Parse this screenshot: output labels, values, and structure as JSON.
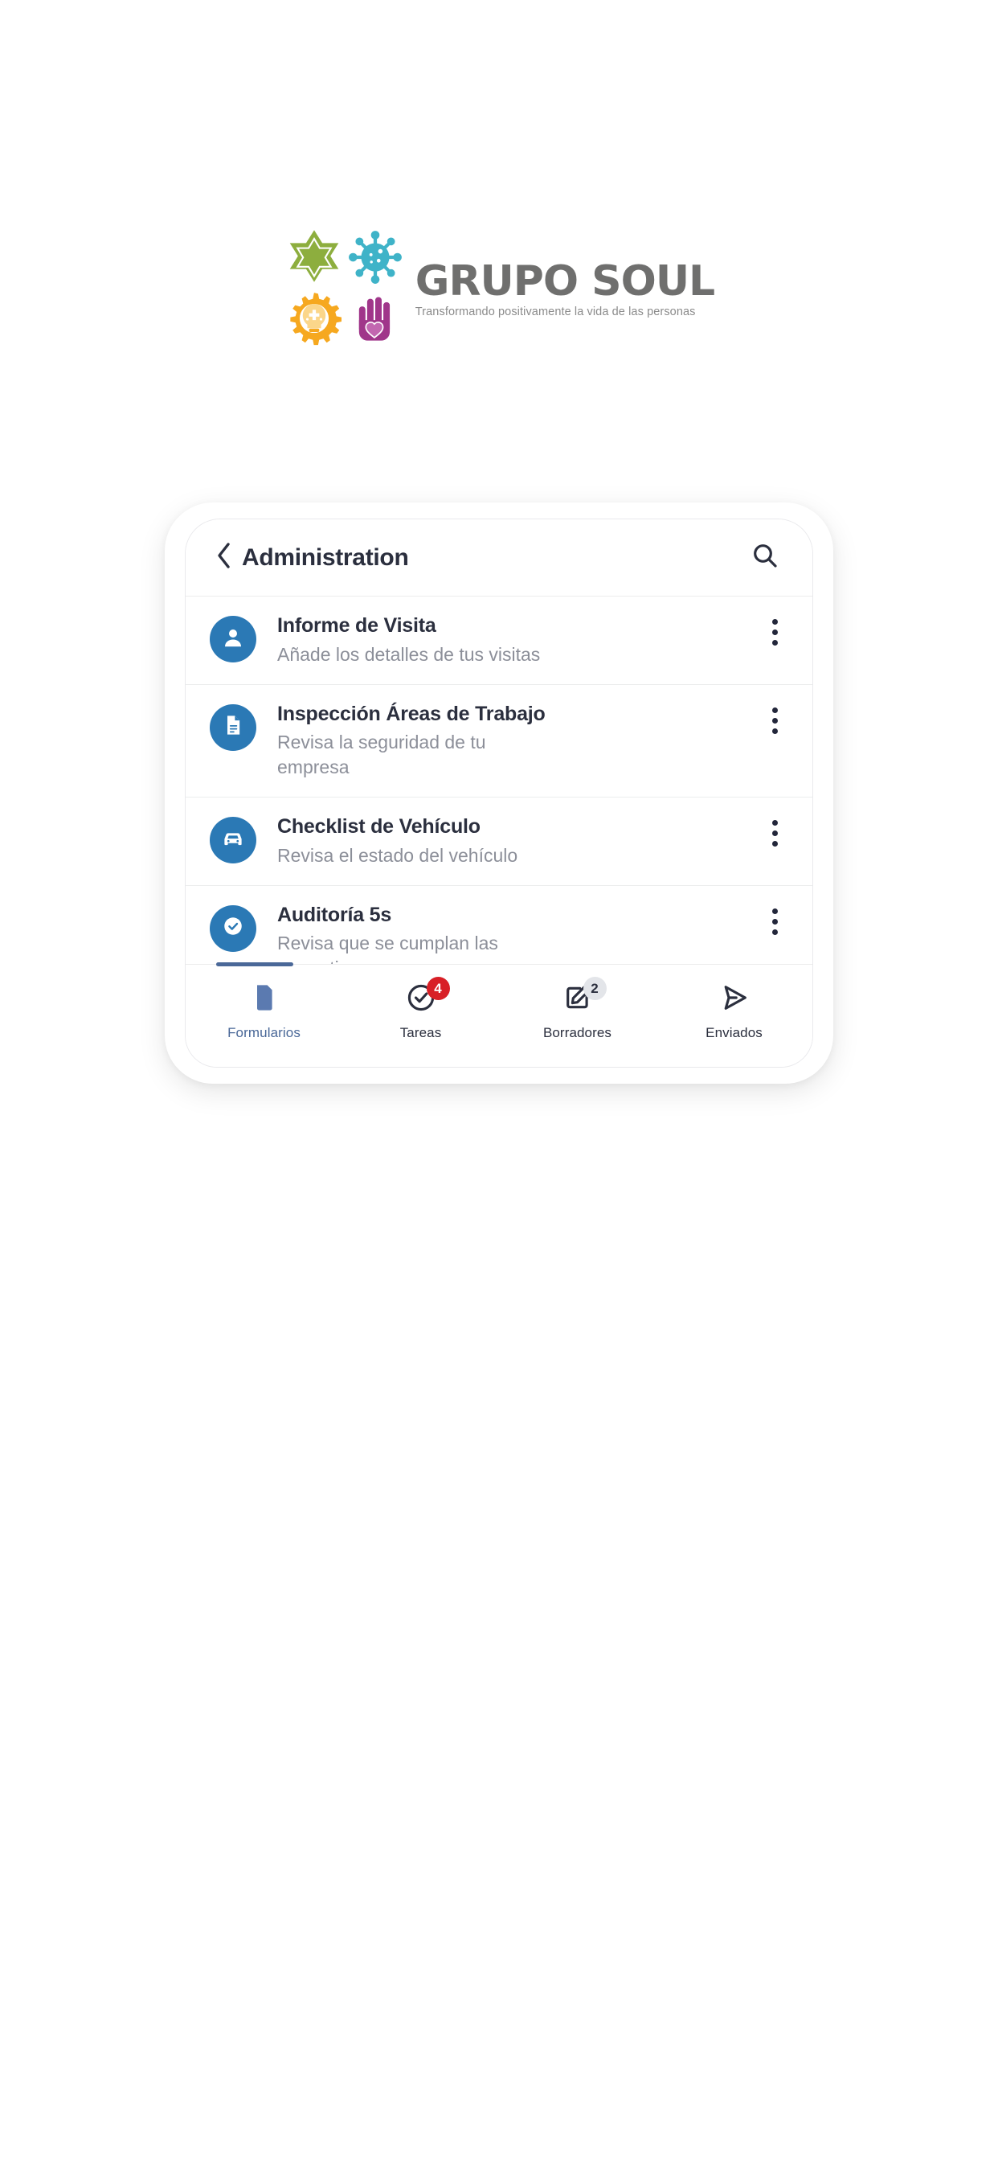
{
  "brand": {
    "name": "GRUPO SOUL",
    "tagline": "Transformando positivamente la vida de las personas",
    "marks": [
      {
        "name": "star-of-david-icon",
        "color": "#8dae3e"
      },
      {
        "name": "virus-icon",
        "color": "#3fb3c8"
      },
      {
        "name": "gear-lightbulb-icon",
        "color": "#f5a623"
      },
      {
        "name": "hand-heart-icon",
        "color": "#a0368a"
      }
    ]
  },
  "appbar": {
    "back_icon": "chevron-left-icon",
    "title": "Administration",
    "search_icon": "search-icon"
  },
  "list": {
    "items": [
      {
        "icon": "person-icon",
        "title": "Informe de Visita",
        "subtitle": "Añade los detalles de tus visitas",
        "menu_icon": "more-vertical-icon"
      },
      {
        "icon": "document-icon",
        "title": "Inspección Áreas de Trabajo",
        "subtitle": "Revisa la seguridad de tu empresa",
        "menu_icon": "more-vertical-icon"
      },
      {
        "icon": "car-icon",
        "title": "Checklist de Vehículo",
        "subtitle": "Revisa el estado del vehículo",
        "menu_icon": "more-vertical-icon"
      },
      {
        "icon": "check-circle-icon",
        "title": "Auditoría 5s",
        "subtitle": "Revisa que se cumplan las normativas",
        "menu_icon": "more-vertical-icon"
      }
    ]
  },
  "bottom_nav": {
    "active_index": 0,
    "items": [
      {
        "icon": "file-icon",
        "label": "Formularios",
        "badge": null,
        "badge_style": null
      },
      {
        "icon": "check-circle-outline-icon",
        "label": "Tareas",
        "badge": "4",
        "badge_style": "red"
      },
      {
        "icon": "edit-square-icon",
        "label": "Borradores",
        "badge": "2",
        "badge_style": "grey"
      },
      {
        "icon": "send-icon",
        "label": "Enviados",
        "badge": null,
        "badge_style": null
      }
    ]
  },
  "colors": {
    "accent_blue": "#2b79b5",
    "active_nav": "#4a6898",
    "badge_red": "#d81f26",
    "badge_grey": "#e3e5e9",
    "text_dark": "#2b2f3e",
    "text_muted": "#8c8f99"
  }
}
